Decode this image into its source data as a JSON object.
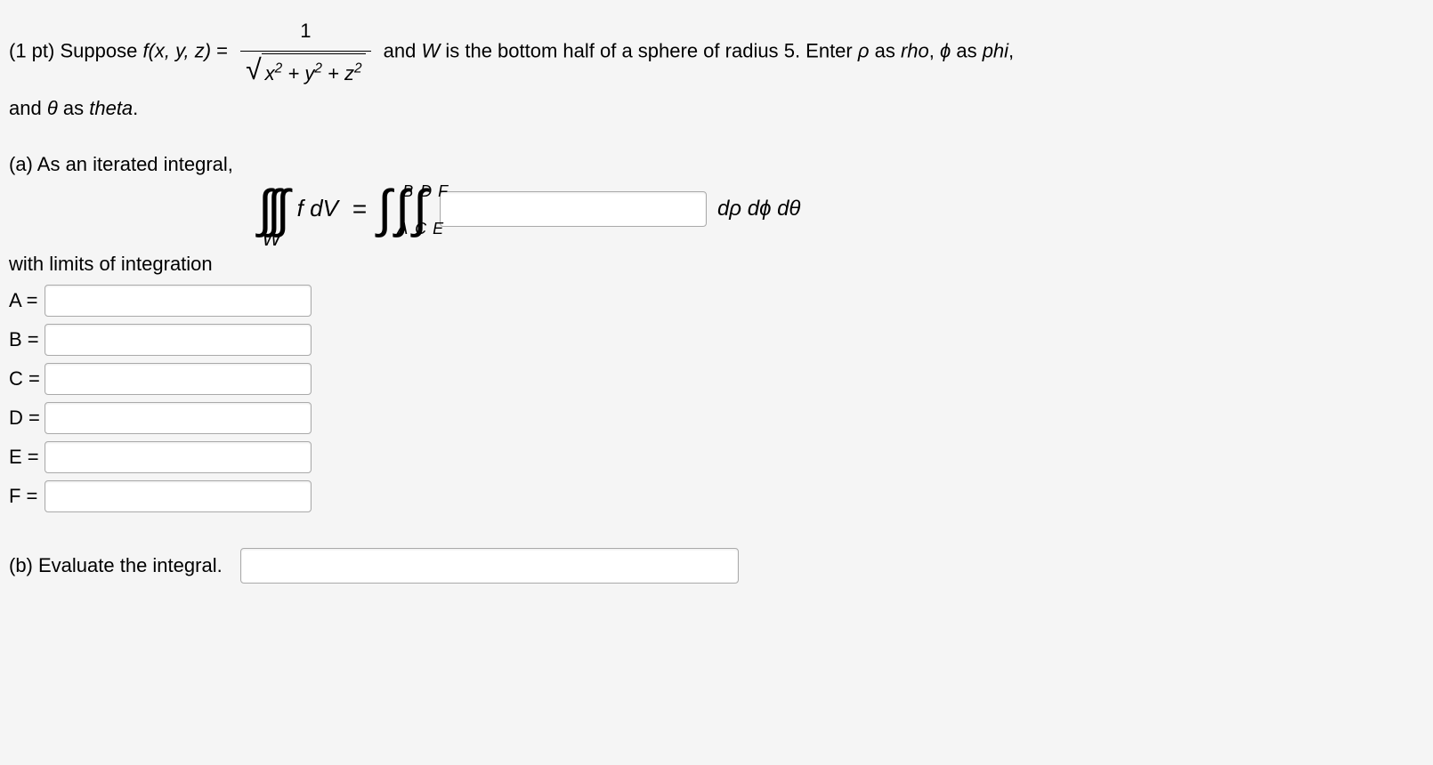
{
  "problem": {
    "points_prefix": "(1 pt) Suppose ",
    "fxyz": "f(x, y, z)",
    "equals": " = ",
    "frac_num": "1",
    "sqrt_inner": "x² + y² + z²",
    "mid_text": " and ",
    "W": "W",
    "after_w": " is the bottom half of a sphere of radius ",
    "radius": "5",
    "period_enter": ". Enter ",
    "rho": "ρ",
    "as_rho": " as ",
    "rho_word": "rho",
    "comma1": ", ",
    "phi": "ϕ",
    "as_phi": " as ",
    "phi_word": "phi",
    "comma2": ",",
    "and_line2": "and ",
    "theta": "θ",
    "as_theta": " as ",
    "theta_word": "theta",
    "period2": "."
  },
  "part_a": {
    "label": "(a) As an iterated integral,",
    "integrand": "f dV",
    "W_sub": "W",
    "bounds": {
      "A": "A",
      "B": "B",
      "C": "C",
      "D": "D",
      "E": "E",
      "F": "F"
    },
    "differentials": "dρ dϕ dθ",
    "limits_text": "with limits of integration",
    "limit_labels": {
      "A": "A =",
      "B": "B =",
      "C": "C =",
      "D": "D =",
      "E": "E =",
      "F": "F ="
    }
  },
  "part_b": {
    "label": "(b) Evaluate the integral."
  }
}
